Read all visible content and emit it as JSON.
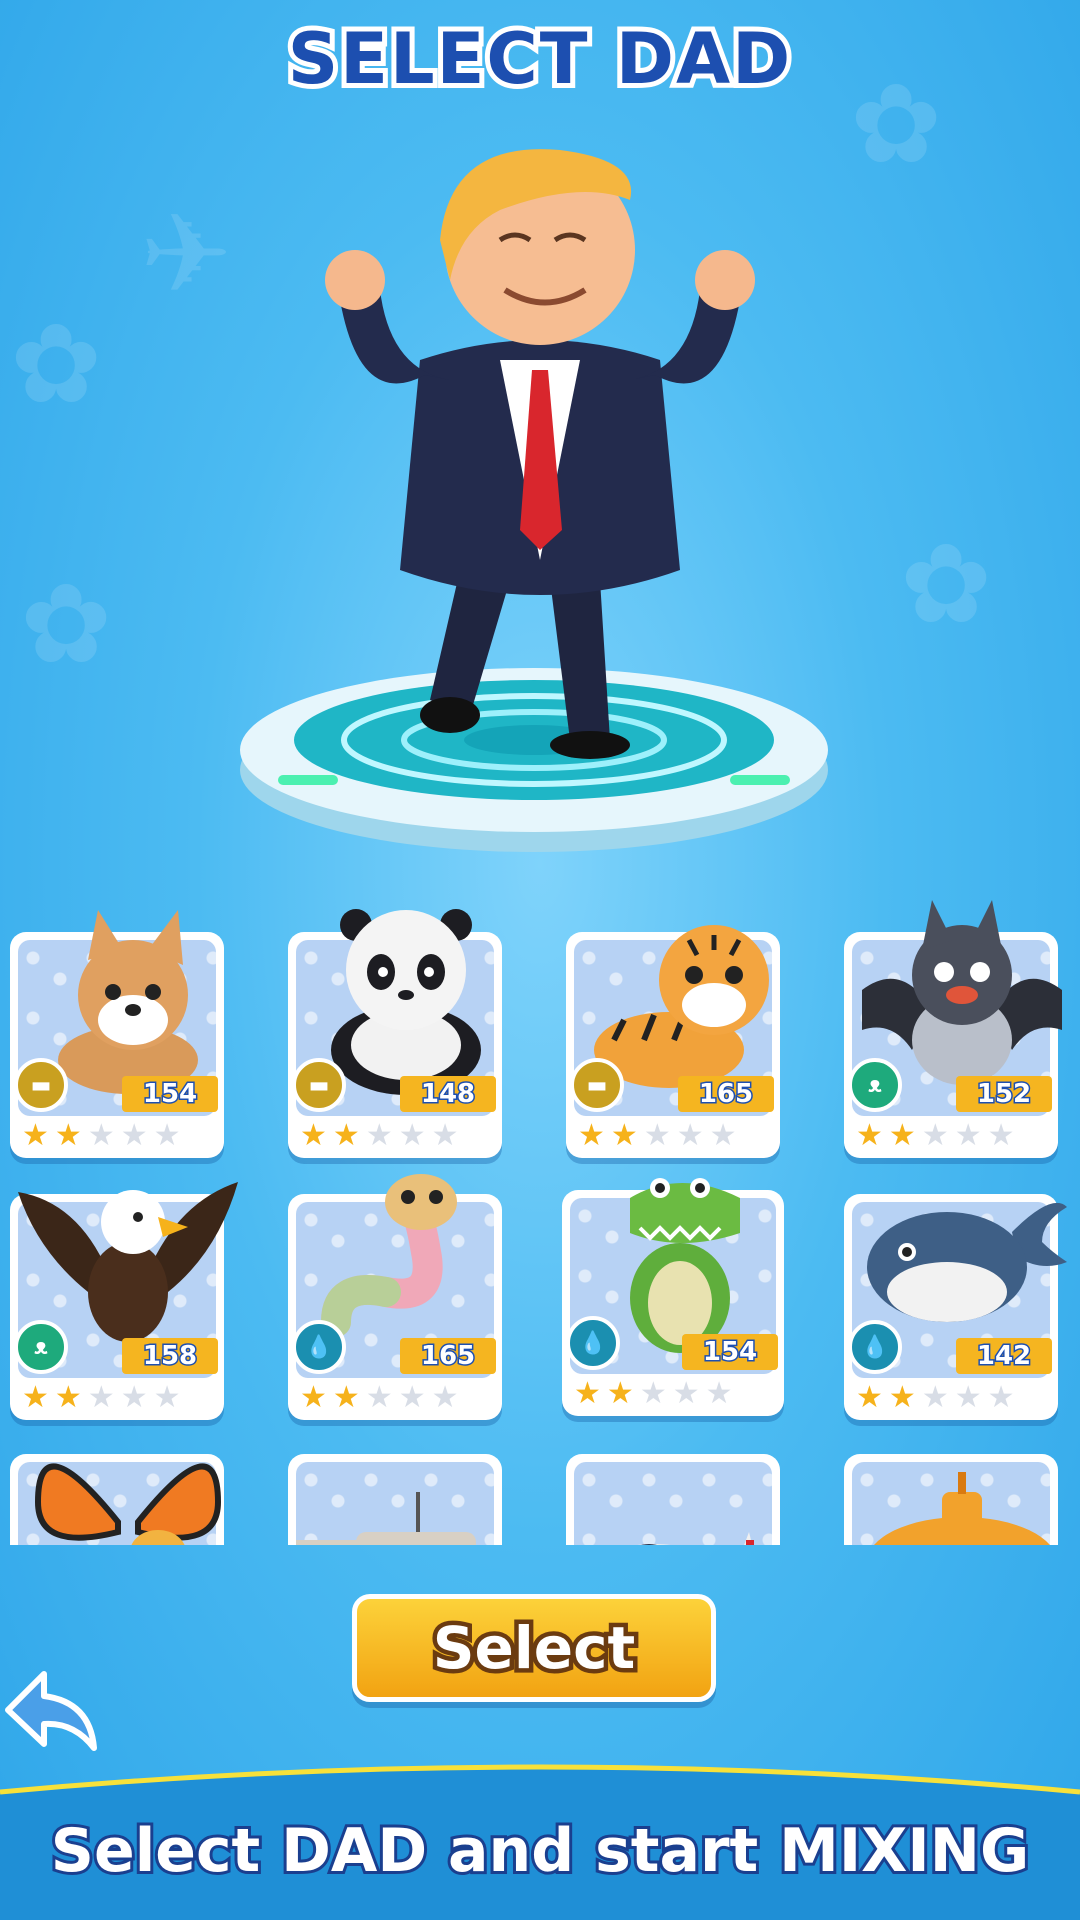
{
  "header": {
    "title": "SELECT DAD"
  },
  "hero": {
    "name": "businessman-dad"
  },
  "cards": [
    {
      "name": "dog",
      "element": "gold",
      "power": "154",
      "stars": 2
    },
    {
      "name": "panda",
      "element": "gold",
      "power": "148",
      "stars": 2
    },
    {
      "name": "tiger",
      "element": "gold",
      "power": "165",
      "stars": 2
    },
    {
      "name": "bat",
      "element": "green",
      "power": "152",
      "stars": 2
    },
    {
      "name": "eagle",
      "element": "green",
      "power": "158",
      "stars": 2
    },
    {
      "name": "snake",
      "element": "teal",
      "power": "165",
      "stars": 2
    },
    {
      "name": "crocodile",
      "element": "teal",
      "power": "154",
      "stars": 2
    },
    {
      "name": "whale",
      "element": "teal",
      "power": "142",
      "stars": 2
    },
    {
      "name": "butterfly"
    },
    {
      "name": "tank"
    },
    {
      "name": "jet"
    },
    {
      "name": "submarine"
    }
  ],
  "actions": {
    "select_label": "Select"
  },
  "footer": {
    "banner_text": "Select DAD and start MIXING"
  },
  "colors": {
    "background": "#4cbbf2",
    "title": "#1d4fb0",
    "button": "#f5b520",
    "star_on": "#f6b21b"
  }
}
